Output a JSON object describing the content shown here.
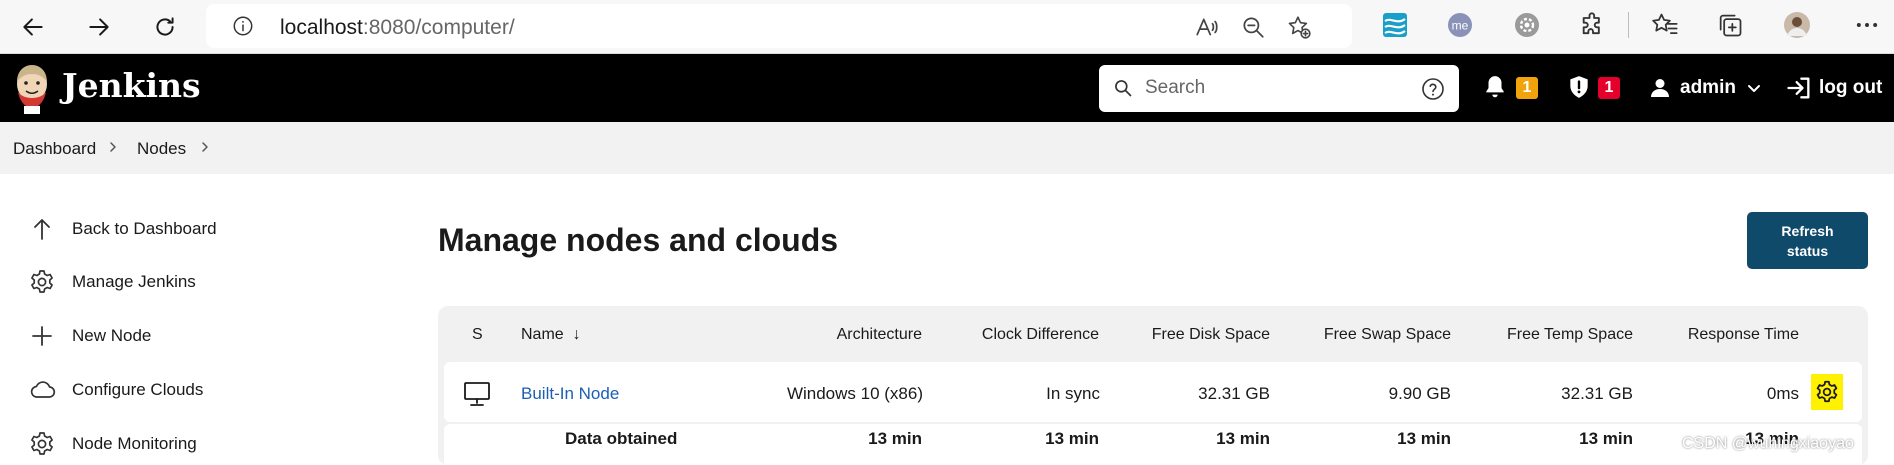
{
  "browser": {
    "url_host": "localhost",
    "url_rest": ":8080/computer/"
  },
  "header": {
    "title": "Jenkins",
    "search_placeholder": "Search",
    "notifications_count": "1",
    "security_count": "1",
    "user": "admin",
    "logout": "log out"
  },
  "breadcrumb": [
    "Dashboard",
    "Nodes"
  ],
  "sidebar": {
    "items": [
      {
        "label": "Back to Dashboard",
        "icon": "arrow-up-icon"
      },
      {
        "label": "Manage Jenkins",
        "icon": "gear-icon"
      },
      {
        "label": "New Node",
        "icon": "plus-icon"
      },
      {
        "label": "Configure Clouds",
        "icon": "cloud-icon"
      },
      {
        "label": "Node Monitoring",
        "icon": "gear-icon"
      }
    ]
  },
  "main": {
    "title": "Manage nodes and clouds",
    "refresh_label_1": "Refresh",
    "refresh_label_2": "status"
  },
  "table": {
    "headers": {
      "s": "S",
      "name": "Name",
      "sort": "↓",
      "architecture": "Architecture",
      "clock": "Clock Difference",
      "disk": "Free Disk Space",
      "swap": "Free Swap Space",
      "temp": "Free Temp Space",
      "response": "Response Time"
    },
    "row": {
      "name": "Built-In Node",
      "architecture": "Windows 10 (x86)",
      "clock": "In sync",
      "disk": "32.31 GB",
      "swap": "9.90 GB",
      "temp": "32.31 GB",
      "response": "0ms"
    },
    "footer": {
      "label": "Data obtained",
      "architecture": "13 min",
      "clock": "13 min",
      "disk": "13 min",
      "swap": "13 min",
      "temp": "13 min",
      "response": "13 min"
    }
  },
  "watermark": "CSDN @wuhingxiaoyao",
  "colors": {
    "header_bg": "#000000",
    "refresh_bg": "#0f4a6b",
    "link": "#1a5fb4",
    "badge_warn": "#f0a30a",
    "badge_danger": "#e4002b",
    "highlight": "#fff200"
  }
}
